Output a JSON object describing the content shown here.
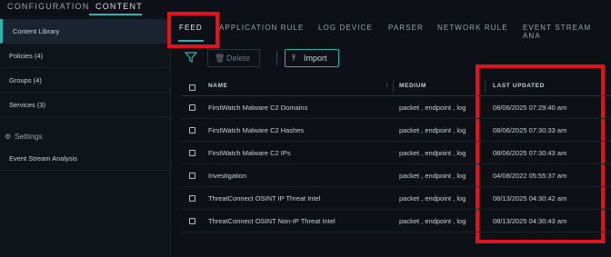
{
  "topnav": {
    "tabs": [
      {
        "label": "CONFIGURATION",
        "active": false
      },
      {
        "label": "CONTENT",
        "active": true
      }
    ]
  },
  "sidebar": {
    "items": [
      {
        "label": "Content Library",
        "active": true
      },
      {
        "label": "Policies (4)",
        "active": false
      },
      {
        "label": "Groups (4)",
        "active": false
      },
      {
        "label": "Services (3)",
        "active": false
      }
    ],
    "settings_label": "Settings",
    "extra_item": "Event Stream Analysis"
  },
  "subtabs": [
    {
      "label": "FEED",
      "active": true
    },
    {
      "label": "APPLICATION RULE",
      "active": false
    },
    {
      "label": "LOG DEVICE",
      "active": false
    },
    {
      "label": "PARSER",
      "active": false
    },
    {
      "label": "NETWORK RULE",
      "active": false
    },
    {
      "label": "EVENT STREAM ANA",
      "active": false
    }
  ],
  "toolbar": {
    "delete_label": "Delete",
    "import_label": "Import"
  },
  "table": {
    "columns": [
      "NAME",
      "MEDIUM",
      "LAST UPDATED"
    ],
    "rows": [
      {
        "name": "FirstWatch Malware C2 Domains",
        "medium": "packet , endpoint , log",
        "updated": "08/06/2025 07:29:40 am"
      },
      {
        "name": "FirstWatch Malware C2 Hashes",
        "medium": "packet , endpoint , log",
        "updated": "08/06/2025 07:30:33 am"
      },
      {
        "name": "FirstWatch Malware C2 IPs",
        "medium": "packet , endpoint , log",
        "updated": "08/06/2025 07:30:43 am"
      },
      {
        "name": "Investigation",
        "medium": "packet , endpoint , log",
        "updated": "04/08/2022 05:55:37 am"
      },
      {
        "name": "ThreatConnect OSINT IP Threat Intel",
        "medium": "packet , endpoint , log",
        "updated": "08/13/2025 04:30:42 am"
      },
      {
        "name": "ThreatConnect OSINT Non-IP Threat Intel",
        "medium": "packet , endpoint , log",
        "updated": "08/13/2025 04:30:43 am"
      }
    ]
  },
  "colors": {
    "accent": "#2fb3ad",
    "highlight": "#e2131c",
    "background": "#0d1117"
  }
}
